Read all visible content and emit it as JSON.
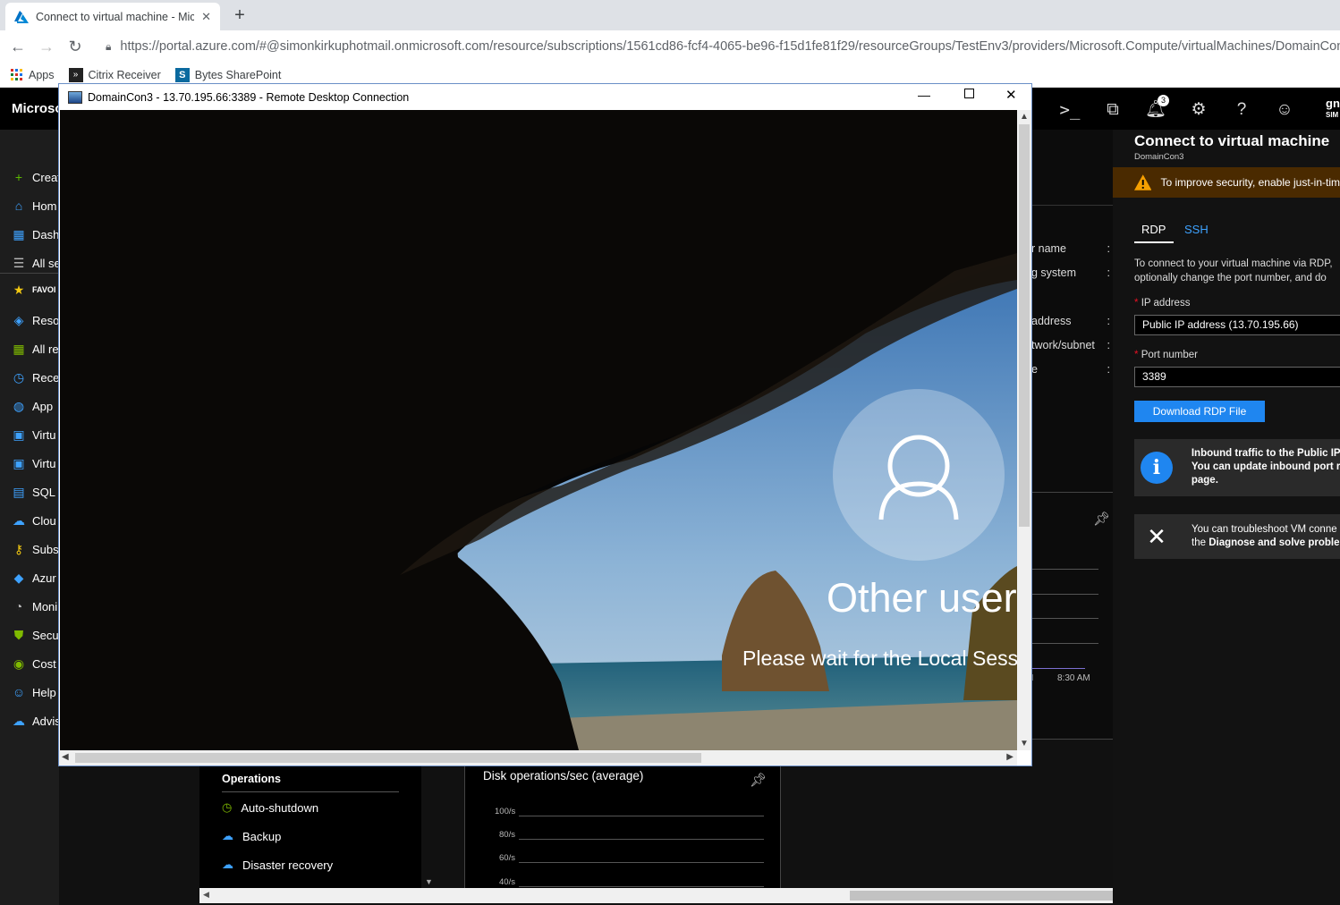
{
  "browser": {
    "tab_title": "Connect to virtual machine - Mic",
    "url": "https://portal.azure.com/#@simonkirkuphotmail.onmicrosoft.com/resource/subscriptions/1561cd86-fcf4-4065-be96-f15d1fe81f29/resourceGroups/TestEnv3/providers/Microsoft.Compute/virtualMachines/DomainCon3/ov",
    "bookmarks": [
      "Apps",
      "Citrix Receiver",
      "Bytes SharePoint"
    ]
  },
  "azure": {
    "brand": "Microso",
    "notification_count": "3",
    "user_initials": "gn",
    "user_sub": "SIM",
    "sidebar": [
      {
        "label": "Creat",
        "icon": "plus-icon",
        "color": "#5bb800"
      },
      {
        "label": "Hom",
        "icon": "home-icon",
        "color": "#3ea2ff"
      },
      {
        "label": "Dash",
        "icon": "dashboard-icon",
        "color": "#3ea2ff"
      },
      {
        "label": "All se",
        "icon": "list-icon",
        "color": "#bbbbbb"
      },
      {
        "label": "FAVOI",
        "icon": "star-icon",
        "color": "#f2c811"
      },
      {
        "label": "Reso",
        "icon": "cube-icon",
        "color": "#3ea2ff"
      },
      {
        "label": "All re",
        "icon": "grid-icon",
        "color": "#7fba00"
      },
      {
        "label": "Rece",
        "icon": "clock-icon",
        "color": "#3ea2ff"
      },
      {
        "label": "App",
        "icon": "globe-icon",
        "color": "#3ea2ff"
      },
      {
        "label": "Virtu",
        "icon": "monitor-icon",
        "color": "#3ea2ff"
      },
      {
        "label": "Virtu",
        "icon": "monitor-icon",
        "color": "#3ea2ff"
      },
      {
        "label": "SQL c",
        "icon": "sql-icon",
        "color": "#3ea2ff"
      },
      {
        "label": "Clou",
        "icon": "cloud-icon",
        "color": "#3ea2ff"
      },
      {
        "label": "Subs",
        "icon": "key-icon",
        "color": "#f2c811"
      },
      {
        "label": "Azur",
        "icon": "diamond-icon",
        "color": "#3ea2ff"
      },
      {
        "label": "Moni",
        "icon": "gauge-icon",
        "color": "#bbbbbb"
      },
      {
        "label": "Secu",
        "icon": "shield-icon",
        "color": "#7fba00"
      },
      {
        "label": "Cost",
        "icon": "coin-icon",
        "color": "#7fba00"
      },
      {
        "label": "Help",
        "icon": "person-icon",
        "color": "#3ea2ff"
      },
      {
        "label": "Advis",
        "icon": "cloud-icon",
        "color": "#3ea2ff"
      }
    ],
    "properties_partial": [
      "r name",
      "g system",
      "address",
      "twork/subnet",
      "e"
    ],
    "operations": {
      "title": "Operations",
      "items": [
        "Auto-shutdown",
        "Backup",
        "Disaster recovery"
      ]
    },
    "chart_time_label": "8:30 AM",
    "chart_time_label_partial": "M",
    "disk_chart": {
      "title": "Disk operations/sec (average)",
      "ticks": [
        "100/s",
        "80/s",
        "60/s",
        "40/s"
      ]
    }
  },
  "blade": {
    "title": "Connect to virtual machine",
    "subtitle": "DomainCon3",
    "warning": "To improve security, enable just-in-tim",
    "tabs": [
      "RDP",
      "SSH"
    ],
    "description_line1": "To connect to your virtual machine via RDP,",
    "description_line2": "optionally change the port number, and do",
    "ip_label": "IP address",
    "ip_value": "Public IP address (13.70.195.66)",
    "port_label": "Port number",
    "port_value": "3389",
    "download_button": "Download RDP File",
    "info_line1": "Inbound traffic to the Public IP a",
    "info_line2": "You can update inbound port ru",
    "info_line3": "page.",
    "tools_line1": "You can troubleshoot VM conne",
    "tools_line2_prefix": "the ",
    "tools_line2_bold": "Diagnose and solve proble",
    "required_mark": "*"
  },
  "rdp": {
    "title": "DomainCon3 - 13.70.195.66:3389 - Remote Desktop Connection",
    "user_label": "Other user",
    "status": "Please wait for the Local Sessi"
  },
  "colors": {
    "azure_blue": "#0078d4",
    "warning_bg": "#4a2a00",
    "button_blue": "#1f86f0"
  }
}
